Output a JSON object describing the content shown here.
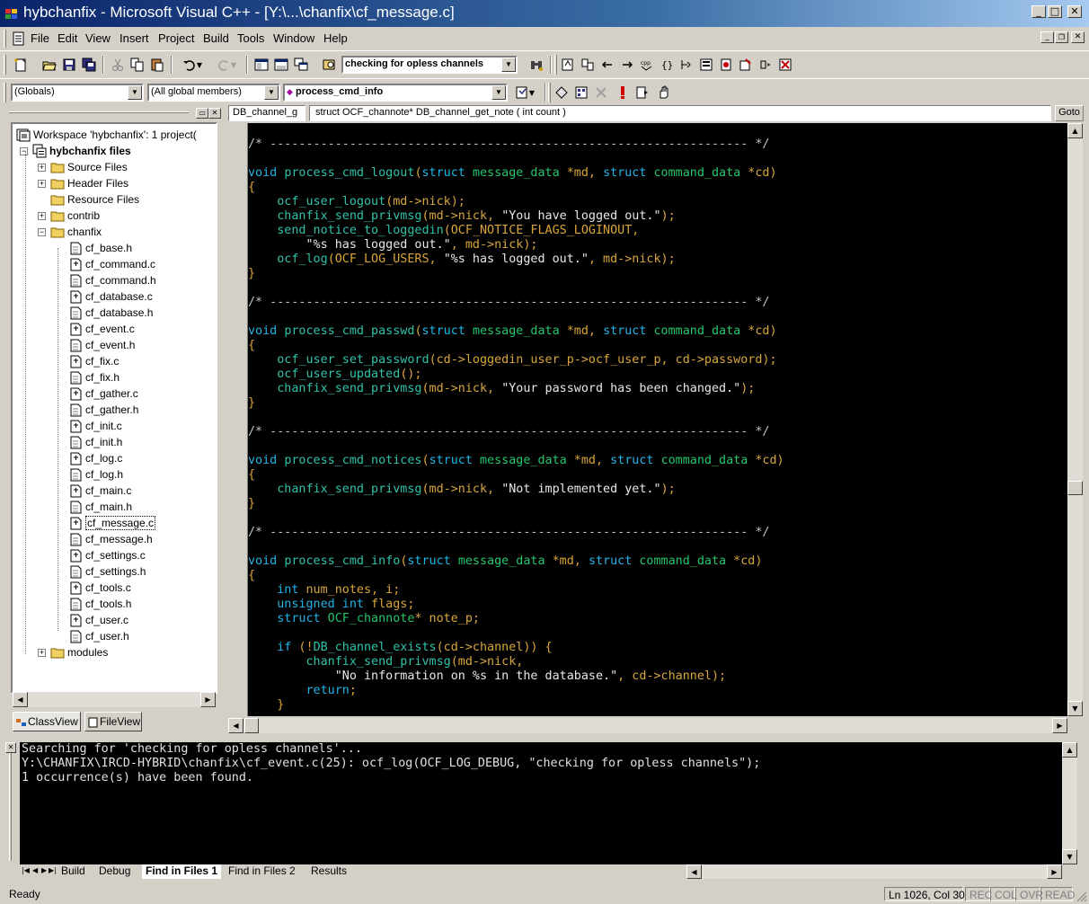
{
  "window": {
    "title": "hybchanfix - Microsoft Visual C++ - [Y:\\...\\chanfix\\cf_message.c]",
    "min_glyph": "_",
    "max_glyph": "□",
    "close_glyph": "✕"
  },
  "menu": [
    "File",
    "Edit",
    "View",
    "Insert",
    "Project",
    "Build",
    "Tools",
    "Window",
    "Help"
  ],
  "toolbar": {
    "find_combo_value": "checking for opless channels"
  },
  "wizardbar": {
    "class_combo": "(Globals)",
    "filter_combo": "(All global members)",
    "member_combo": "process_cmd_info"
  },
  "navbar": {
    "context_left": "DB_channel_g",
    "context_signature": "struct OCF_channote* DB_channel_get_note ( int count )",
    "goto_label": "Goto"
  },
  "workspace": {
    "root": "Workspace 'hybchanfix': 1 project(",
    "project": "hybchanfix files",
    "folders": [
      "Source Files",
      "Header Files",
      "Resource Files",
      "contrib",
      "chanfix",
      "modules"
    ],
    "files": [
      "cf_base.h",
      "cf_command.c",
      "cf_command.h",
      "cf_database.c",
      "cf_database.h",
      "cf_event.c",
      "cf_event.h",
      "cf_fix.c",
      "cf_fix.h",
      "cf_gather.c",
      "cf_gather.h",
      "cf_init.c",
      "cf_init.h",
      "cf_log.c",
      "cf_log.h",
      "cf_main.c",
      "cf_main.h",
      "cf_message.c",
      "cf_message.h",
      "cf_settings.c",
      "cf_settings.h",
      "cf_tools.c",
      "cf_tools.h",
      "cf_user.c",
      "cf_user.h"
    ],
    "selected_file": "cf_message.c",
    "tabs": [
      "ClassView",
      "FileView"
    ]
  },
  "colors": {
    "keyword": "#22b3e6",
    "type": "#27c56b",
    "function": "#2fc2a8",
    "text": "#d9a53c",
    "string": "#e8e8e8",
    "titlebar": "#0a246a"
  },
  "code": [
    {
      "t": "cm",
      "s": "/* ------------------------------------------------------------------ */"
    },
    {
      "t": "blank",
      "s": ""
    },
    {
      "t": "sig",
      "void": "void",
      "fn": "process_cmd_logout",
      "a1": "(",
      "k1": "struct",
      "ty1": "message_data",
      "v1": " *md, ",
      "k2": "struct",
      "ty2": "command_data",
      "v2": " *cd)"
    },
    {
      "t": "tx",
      "s": "{"
    },
    {
      "t": "call",
      "ind": "    ",
      "fn": "ocf_user_logout",
      "rest": "(md->nick);",
      "str": "",
      "tail": ""
    },
    {
      "t": "call",
      "ind": "    ",
      "fn": "chanfix_send_privmsg",
      "rest": "(md->nick, ",
      "str": "\"You have logged out.\"",
      "tail": ");"
    },
    {
      "t": "call",
      "ind": "    ",
      "fn": "send_notice_to_loggedin",
      "rest": "(OCF_NOTICE_FLAGS_LOGINOUT,",
      "str": "",
      "tail": ""
    },
    {
      "t": "cont",
      "ind": "        ",
      "str": "\"%s has logged out.\"",
      "tail": ", md->nick);"
    },
    {
      "t": "call",
      "ind": "    ",
      "fn": "ocf_log",
      "rest": "(OCF_LOG_USERS, ",
      "str": "\"%s has logged out.\"",
      "tail": ", md->nick);"
    },
    {
      "t": "tx",
      "s": "}"
    },
    {
      "t": "blank",
      "s": ""
    },
    {
      "t": "cm",
      "s": "/* ------------------------------------------------------------------ */"
    },
    {
      "t": "blank",
      "s": ""
    },
    {
      "t": "sig",
      "void": "void",
      "fn": "process_cmd_passwd",
      "a1": "(",
      "k1": "struct",
      "ty1": "message_data",
      "v1": " *md, ",
      "k2": "struct",
      "ty2": "command_data",
      "v2": " *cd)"
    },
    {
      "t": "tx",
      "s": "{"
    },
    {
      "t": "call",
      "ind": "    ",
      "fn": "ocf_user_set_password",
      "rest": "(cd->loggedin_user_p->ocf_user_p, cd->password);",
      "str": "",
      "tail": ""
    },
    {
      "t": "call",
      "ind": "    ",
      "fn": "ocf_users_updated",
      "rest": "();",
      "str": "",
      "tail": ""
    },
    {
      "t": "call",
      "ind": "    ",
      "fn": "chanfix_send_privmsg",
      "rest": "(md->nick, ",
      "str": "\"Your password has been changed.\"",
      "tail": ");"
    },
    {
      "t": "tx",
      "s": "}"
    },
    {
      "t": "blank",
      "s": ""
    },
    {
      "t": "cm",
      "s": "/* ------------------------------------------------------------------ */"
    },
    {
      "t": "blank",
      "s": ""
    },
    {
      "t": "sig",
      "void": "void",
      "fn": "process_cmd_notices",
      "a1": "(",
      "k1": "struct",
      "ty1": "message_data",
      "v1": " *md, ",
      "k2": "struct",
      "ty2": "command_data",
      "v2": " *cd)"
    },
    {
      "t": "tx",
      "s": "{"
    },
    {
      "t": "call",
      "ind": "    ",
      "fn": "chanfix_send_privmsg",
      "rest": "(md->nick, ",
      "str": "\"Not implemented yet.\"",
      "tail": ");"
    },
    {
      "t": "tx",
      "s": "}"
    },
    {
      "t": "blank",
      "s": ""
    },
    {
      "t": "cm",
      "s": "/* ------------------------------------------------------------------ */"
    },
    {
      "t": "blank",
      "s": ""
    },
    {
      "t": "sig",
      "void": "void",
      "fn": "process_cmd_info",
      "a1": "(",
      "k1": "struct",
      "ty1": "message_data",
      "v1": " *md, ",
      "k2": "struct",
      "ty2": "command_data",
      "v2": " *cd)"
    },
    {
      "t": "tx",
      "s": "{"
    },
    {
      "t": "decl",
      "ind": "    ",
      "kw": "int",
      "ty": "",
      "rest": " num_notes, i;"
    },
    {
      "t": "decl",
      "ind": "    ",
      "kw": "unsigned int",
      "ty": "",
      "rest": " flags;"
    },
    {
      "t": "decl",
      "ind": "    ",
      "kw": "struct",
      "ty": " OCF_channote",
      "rest": "* note_p;"
    },
    {
      "t": "blank",
      "s": ""
    },
    {
      "t": "if",
      "ind": "    ",
      "kw": "if",
      "rest": " (!",
      "fn": "DB_channel_exists",
      "tail": "(cd->channel)) {"
    },
    {
      "t": "call",
      "ind": "        ",
      "fn": "chanfix_send_privmsg",
      "rest": "(md->nick,",
      "str": "",
      "tail": ""
    },
    {
      "t": "cont",
      "ind": "            ",
      "str": "\"No information on %s in the database.\"",
      "tail": ", cd->channel);"
    },
    {
      "t": "kwline",
      "ind": "        ",
      "kw": "return",
      "rest": ";"
    },
    {
      "t": "tx",
      "s": "    }"
    }
  ],
  "output": {
    "lines": [
      "Searching for 'checking for opless channels'...",
      "Y:\\CHANFIX\\IRCD-HYBRID\\chanfix\\cf_event.c(25):  ocf_log(OCF_LOG_DEBUG, \"checking for opless channels\");",
      "1 occurrence(s) have been found."
    ],
    "tabs": [
      "Build",
      "Debug",
      "Find in Files 1",
      "Find in Files 2",
      "Results"
    ],
    "active_tab": "Find in Files 1"
  },
  "status": {
    "ready": "Ready",
    "position": "Ln 1026, Col 30",
    "indicators": [
      "REC",
      "COL",
      "OVR",
      "READ"
    ]
  }
}
